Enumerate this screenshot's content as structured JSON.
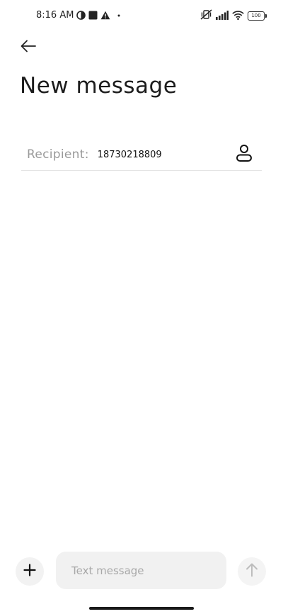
{
  "status_bar": {
    "time": "8:16 AM",
    "battery_level": "100",
    "icons": [
      "pie-chart-icon",
      "square-icon",
      "warning-icon",
      "dot-icon",
      "vibrate-off-icon",
      "signal-icon",
      "wifi-icon",
      "battery-icon"
    ]
  },
  "header": {
    "back_icon": "arrow-left-icon",
    "title": "New message"
  },
  "recipient": {
    "label": "Recipient:",
    "value": "18730218809",
    "contact_icon": "person-icon"
  },
  "composer": {
    "attach_icon": "plus-icon",
    "placeholder": "Text message",
    "value": "",
    "send_icon": "arrow-up-icon"
  },
  "colors": {
    "background": "#ffffff",
    "field_background": "#f1f1f1",
    "label_gray": "#9a9a9a",
    "divider": "#e4e4e4",
    "send_disabled": "#bdbdbd"
  }
}
